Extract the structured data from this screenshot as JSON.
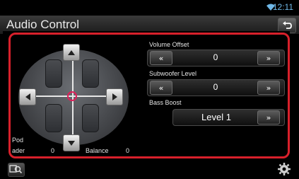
{
  "status": {
    "clock": "12:11"
  },
  "header": {
    "title": "Audio Control"
  },
  "controls": {
    "volume_offset": {
      "label": "Volume Offset",
      "value": "0",
      "left": "«",
      "right": "»"
    },
    "subwoofer_level": {
      "label": "Subwoofer Level",
      "value": "0",
      "left": "«",
      "right": "»"
    },
    "bass_boost": {
      "label": "Bass Boost",
      "value": "Level 1",
      "right": "»"
    }
  },
  "position": {
    "pod_label": "Pod",
    "fader_label": "ader",
    "fader_value": "0",
    "balance_label": "Balance",
    "balance_value": "0"
  },
  "icons": [
    "wifi-icon",
    "back-icon",
    "arrow-up-icon",
    "arrow-down-icon",
    "arrow-left-icon",
    "arrow-right-icon",
    "search-music-icon",
    "gear-icon"
  ],
  "colors": {
    "highlight": "#d8202b",
    "target": "#e0205a",
    "clock": "#6fb8e8"
  }
}
